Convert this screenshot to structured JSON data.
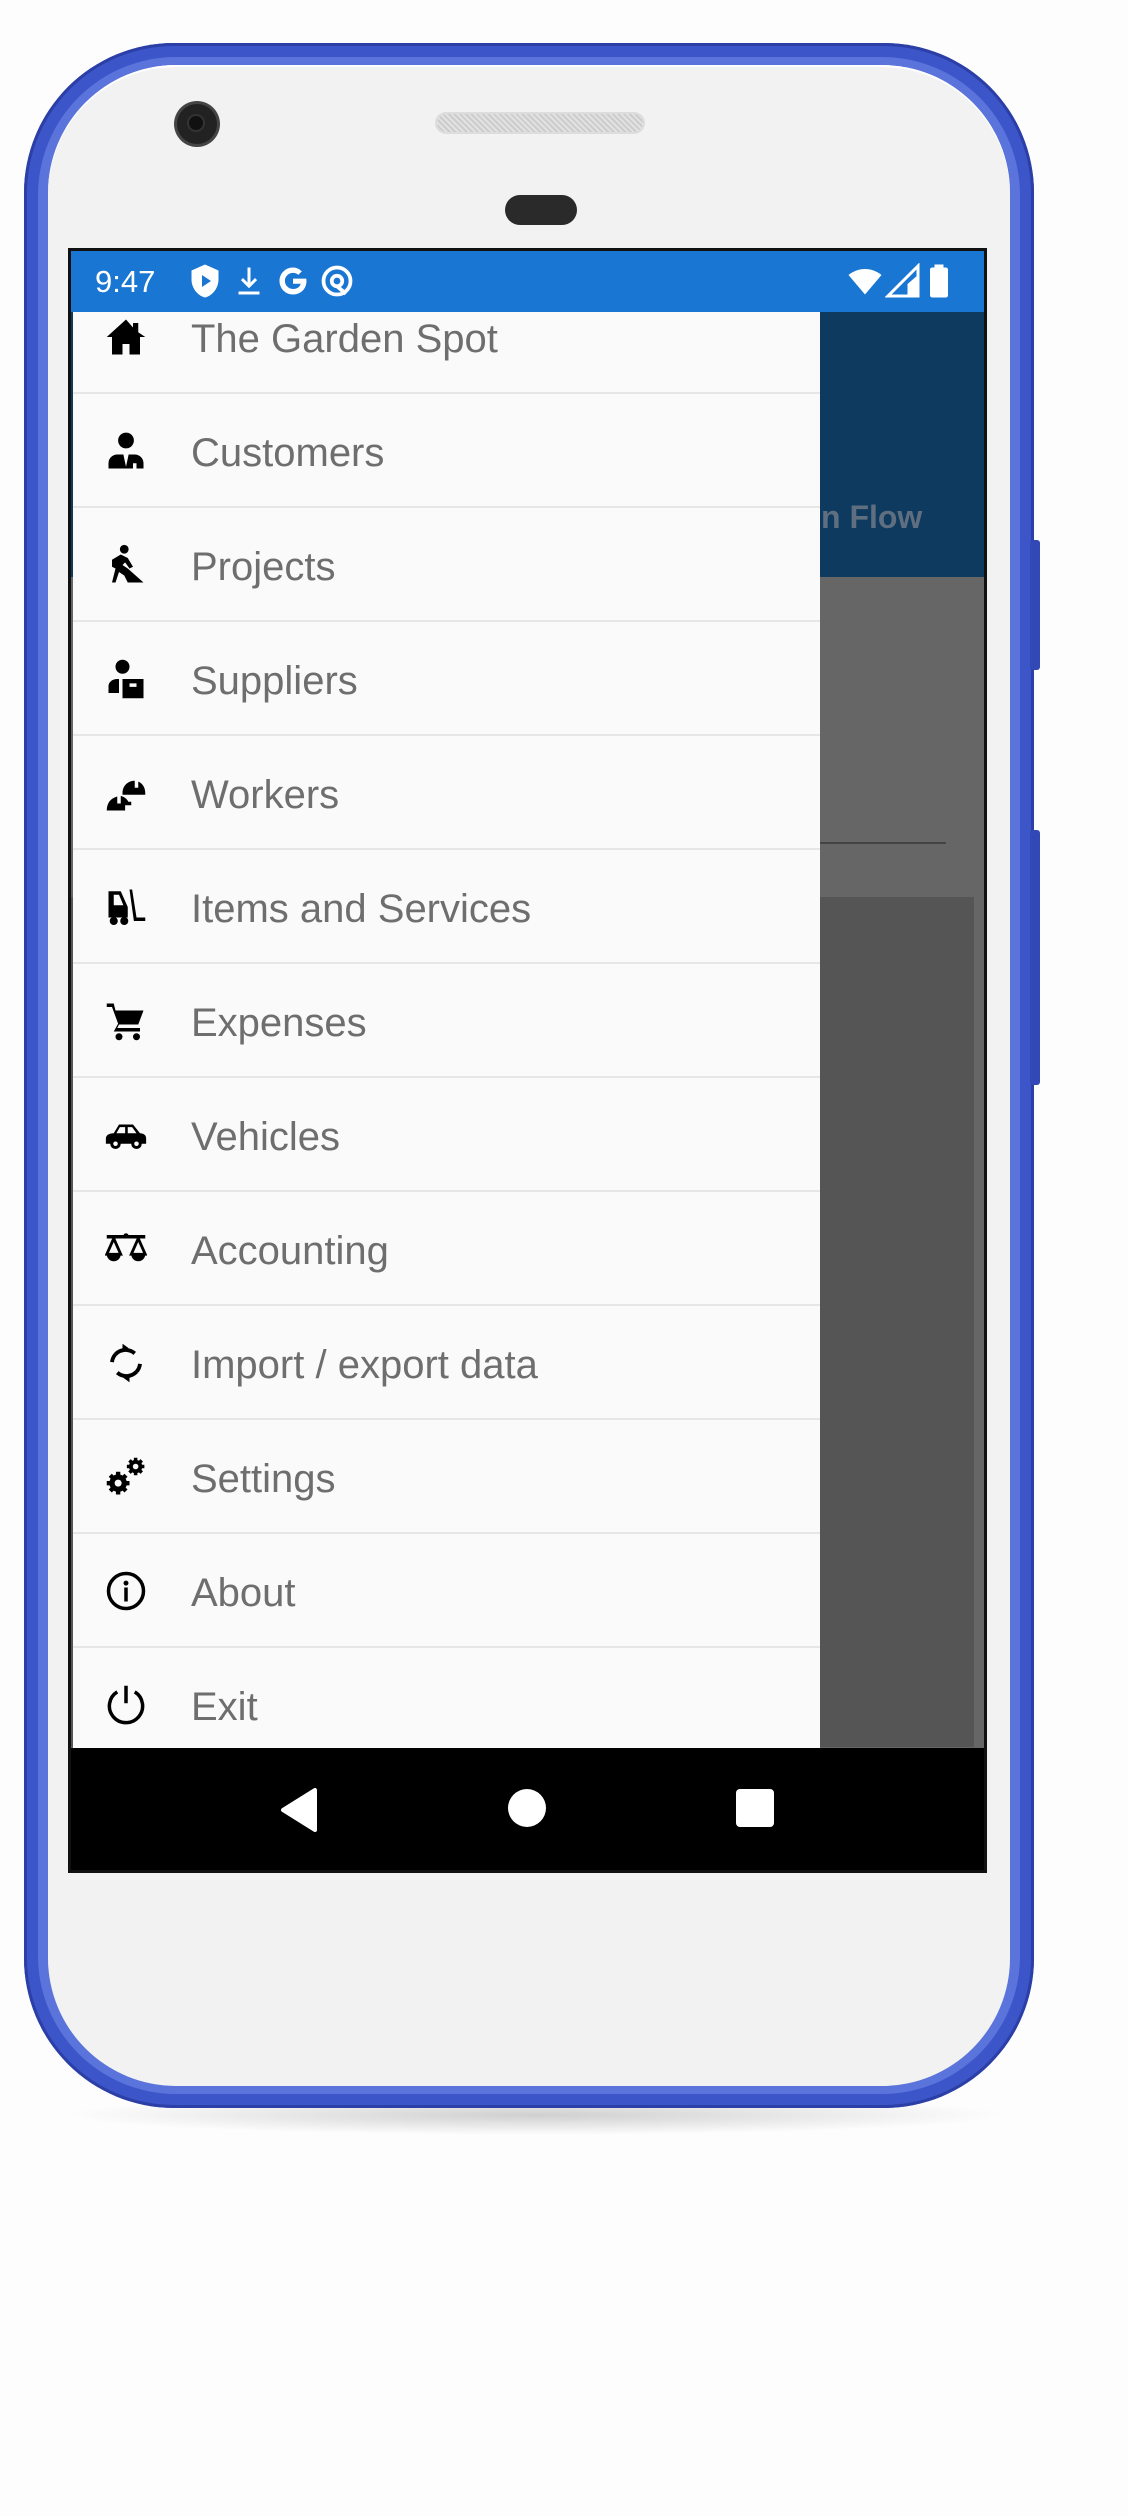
{
  "status_bar": {
    "time": "9:47",
    "left_icons": [
      "play-protect-icon",
      "download-icon",
      "google-icon",
      "at-sign-icon"
    ],
    "right_icons": [
      "wifi-icon",
      "cell-signal-icon",
      "battery-icon"
    ]
  },
  "background_app": {
    "tab_partial_label": "n Flow",
    "toolbar_color": "#0d3a5e"
  },
  "drawer": {
    "items": [
      {
        "label": "The Garden Spot",
        "icon": "house-icon"
      },
      {
        "label": "Customers",
        "icon": "customer-icon"
      },
      {
        "label": "Projects",
        "icon": "worker-digging-icon"
      },
      {
        "label": "Suppliers",
        "icon": "person-box-icon"
      },
      {
        "label": "Workers",
        "icon": "hard-hat-icon"
      },
      {
        "label": "Items and Services",
        "icon": "forklift-icon"
      },
      {
        "label": "Expenses",
        "icon": "cart-icon"
      },
      {
        "label": "Vehicles",
        "icon": "car-icon"
      },
      {
        "label": "Accounting",
        "icon": "balance-scale-icon"
      },
      {
        "label": "Import / export data",
        "icon": "sync-icon"
      },
      {
        "label": "Settings",
        "icon": "gears-icon"
      },
      {
        "label": "About",
        "icon": "info-icon"
      },
      {
        "label": "Exit",
        "icon": "power-icon"
      }
    ]
  },
  "nav_bar": {
    "buttons": [
      "back",
      "home",
      "recents"
    ]
  },
  "colors": {
    "status_bar": "#1976d2",
    "phone_frame": "#3c55c8",
    "drawer_bg": "#fafafa",
    "drawer_text": "#6e6e6e"
  }
}
